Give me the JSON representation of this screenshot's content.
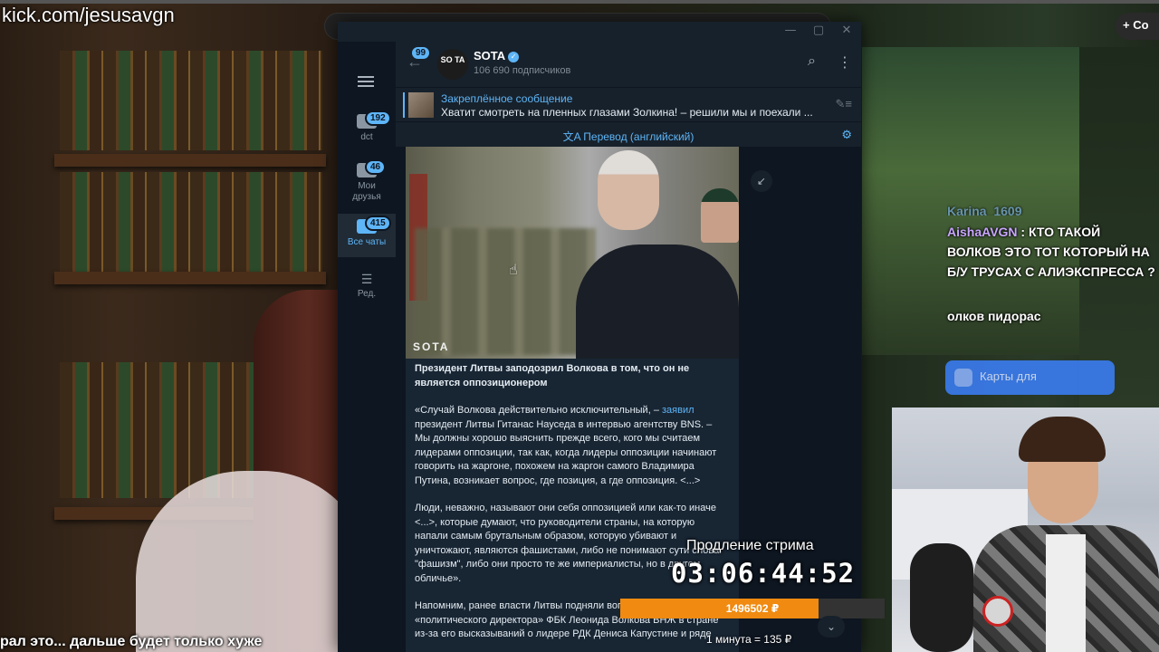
{
  "stream": {
    "url": "kick.com/jesusavgn",
    "subtitle": "рал это... дальше будет только хуже",
    "create_label": "+ Со"
  },
  "telegram": {
    "window_controls": [
      "—",
      "▢",
      "✕"
    ],
    "folders": [
      {
        "label": "dct",
        "badge": "192"
      },
      {
        "label": "Мои друзья",
        "badge": "46"
      },
      {
        "label": "Все чаты",
        "badge": "415",
        "active": true
      },
      {
        "label": "Ред.",
        "badge": ""
      }
    ],
    "back_badge": "99",
    "channel": {
      "avatar_text": "SO TA",
      "name": "SOTA",
      "subscribers": "106 690 подписчиков"
    },
    "pinned": {
      "title": "Закреплённое сообщение",
      "text": "Хватит смотреть на пленных глазами Золкина! – решили мы и поехали ..."
    },
    "translate_label": "Перевод (английский)",
    "post": {
      "watermark": "SOTA",
      "headline": "Президент Литвы заподозрил Волкова в том, что он не является оппозиционером",
      "p1_a": "«Случай Волкова действительно исключительный, – ",
      "p1_link": "заявил",
      "p1_b": " президент Литвы Гитанас Науседа в интервью агентству BNS. – Мы должны хорошо выяснить прежде всего, кого мы считаем лидерами оппозиции, так как, когда лидеры оппозиции начинают говорить на жаргоне, похожем на жаргон самого Владимира Путина, возникает вопрос, где позиция, а где оппозиция. <...>",
      "p2": "Люди, неважно, называют они себя оппозицией или как-то иначе  <...>, которые думают, что руководители страны, на которую напали самым брутальным образом, которую убивают и уничтожают, являются фашистами, либо не понимают сути слова \"фашизм\", либо они просто те же империалисты, но в другом обличье».",
      "p3": "Напомним, ранее власти Литвы подняли вопрос о лишении «политического директора» ФБК Леонида Волкова ВНЖ в стране из-за его высказываний о лидере РДК Дениса Капустине и ряде"
    }
  },
  "chat": {
    "messages": [
      {
        "user": "Karina_1609",
        "text": ""
      },
      {
        "user": "AishaAVGN",
        "text": "КТО ТАКОЙ ВОЛКОВ ЭТО ТОТ КОТОРЫЙ НА Б/У ТРУСАХ С АЛИЭКСПРЕССА ?"
      },
      {
        "user": "",
        "text": "олков пидорас"
      }
    ],
    "banner_text": "Карты для"
  },
  "extension": {
    "title": "Продление стрима",
    "timer": "03:06:44:52",
    "amount": "1496502 ₽",
    "progress": 0.75,
    "rate": "1 минута = 135 ₽"
  },
  "colors": {
    "telegram_accent": "#5eb5f7",
    "telegram_bg": "#17212b",
    "progress_fill": "#f08a10"
  }
}
